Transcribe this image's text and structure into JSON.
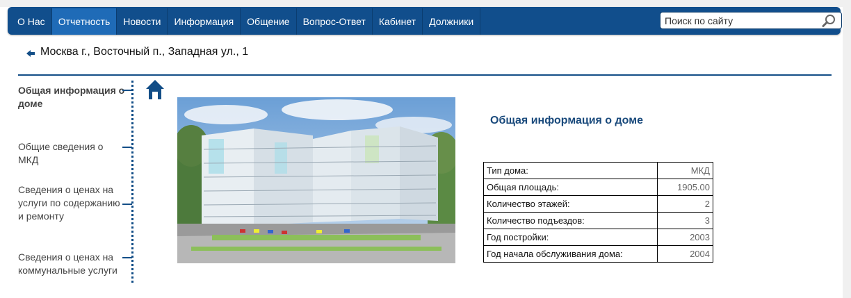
{
  "nav": {
    "items": [
      {
        "label": "О Нас",
        "active": false
      },
      {
        "label": "Отчетность",
        "active": true
      },
      {
        "label": "Новости",
        "active": false
      },
      {
        "label": "Информация",
        "active": false
      },
      {
        "label": "Общение",
        "active": false
      },
      {
        "label": "Вопрос-Ответ",
        "active": false
      },
      {
        "label": "Кабинет",
        "active": false
      },
      {
        "label": "Должники",
        "active": false
      }
    ],
    "search_placeholder": "Поиск по сайту",
    "search_icon": "magnifier-icon"
  },
  "colors": {
    "nav_bg": "#114e8c",
    "nav_active": "#1f6bb7",
    "accent": "#134e87",
    "title": "#1a4a7c"
  },
  "address": "Москва г., Восточный п., Западная ул., 1",
  "sidebar": {
    "items": [
      {
        "label": "Общая информация о доме",
        "active": true
      },
      {
        "label": "Общие сведения о МКД",
        "active": false
      },
      {
        "label": "Сведения о ценах на услуги по содержанию и ремонту",
        "active": false
      },
      {
        "label": "Сведения о ценах на коммунальные услуги",
        "active": false
      }
    ]
  },
  "info": {
    "title": "Общая информация о доме",
    "rows": [
      {
        "key": "Тип дома:",
        "value": "МКД"
      },
      {
        "key": "Общая площадь:",
        "value": "1905.00"
      },
      {
        "key": "Количество этажей:",
        "value": "2"
      },
      {
        "key": "Количество подъездов:",
        "value": "3"
      },
      {
        "key": "Год постройки:",
        "value": "2003"
      },
      {
        "key": "Год начала обслуживания дома:",
        "value": "2004"
      }
    ]
  }
}
